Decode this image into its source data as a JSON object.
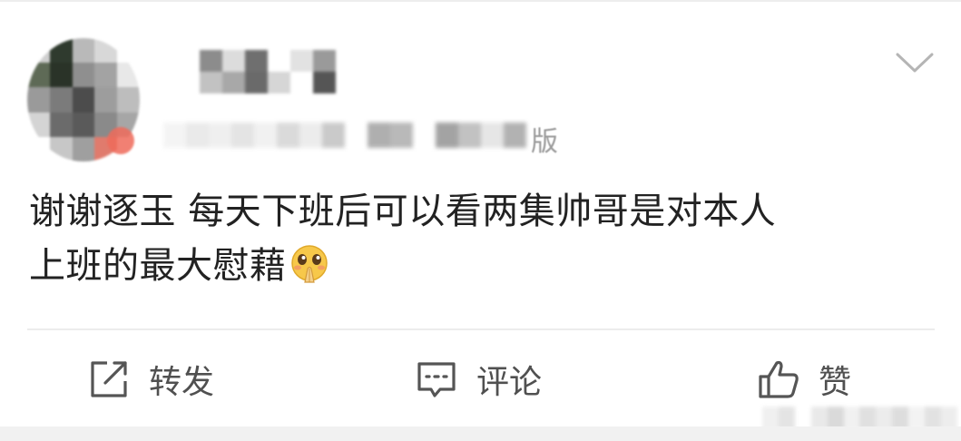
{
  "post": {
    "header": {
      "username": "",
      "source": "版"
    },
    "text_line1": "谢谢逐玉 每天下班后可以看两集帅哥是对本人",
    "text_line2": "上班的最大慰藉",
    "emoji": "pray-emoji"
  },
  "actions": {
    "repost_label": "转发",
    "comment_label": "评论",
    "like_label": "赞"
  },
  "colors": {
    "text": "#222222",
    "muted": "#9a9a9a",
    "divider": "#ececec",
    "action": "#505050"
  }
}
